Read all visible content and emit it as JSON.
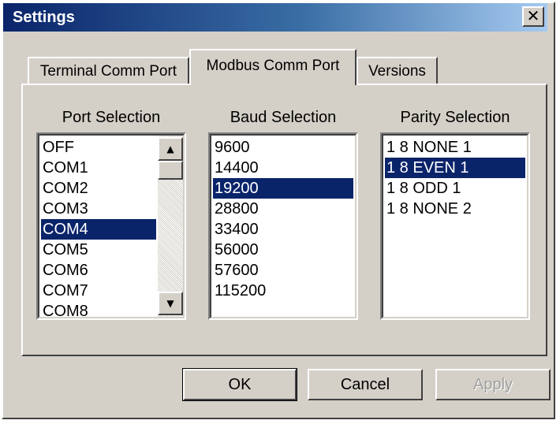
{
  "window": {
    "title": "Settings",
    "close_glyph": "✕"
  },
  "tabs": [
    {
      "label": "Terminal Comm Port",
      "selected": false
    },
    {
      "label": "Modbus Comm Port",
      "selected": true
    },
    {
      "label": "Versions",
      "selected": false
    }
  ],
  "port": {
    "label": "Port Selection",
    "items": [
      "OFF",
      "COM1",
      "COM2",
      "COM3",
      "COM4",
      "COM5",
      "COM6",
      "COM7",
      "COM8"
    ],
    "selected": "COM4",
    "scroll_up_glyph": "▲",
    "scroll_down_glyph": "▼"
  },
  "baud": {
    "label": "Baud Selection",
    "items": [
      "9600",
      "14400",
      "19200",
      "28800",
      "33400",
      "56000",
      "57600",
      "115200"
    ],
    "selected": "19200"
  },
  "parity": {
    "label": "Parity Selection",
    "items": [
      "1 8 NONE 1",
      "1 8 EVEN 1",
      "1 8 ODD 1",
      "1 8 NONE 2"
    ],
    "selected": "1 8 EVEN 1"
  },
  "buttons": {
    "ok": "OK",
    "cancel": "Cancel",
    "apply": "Apply"
  },
  "colors": {
    "selection": "#0a246a",
    "face": "#d4d0c8",
    "title_start": "#0a246a",
    "title_end": "#a6caf0"
  }
}
